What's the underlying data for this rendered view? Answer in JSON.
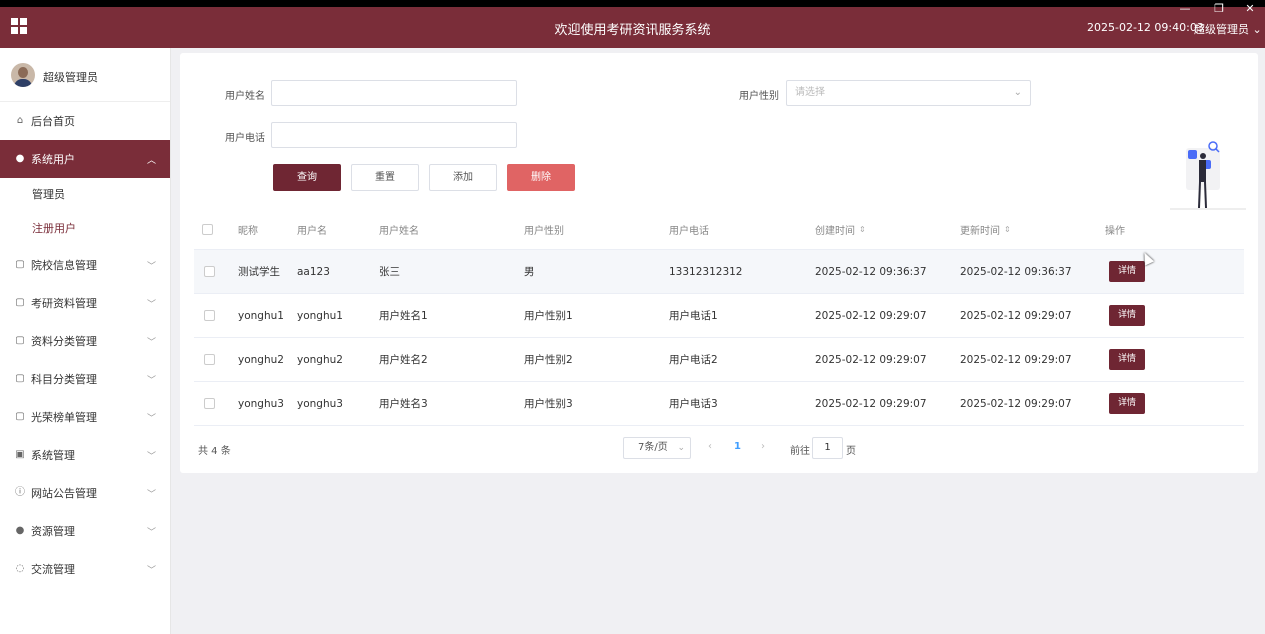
{
  "window": {
    "minimize": "—",
    "restore": "❐",
    "close": "✕"
  },
  "header": {
    "title": "欢迎使用考研资讯服务系统",
    "datetime": "2025-02-12 09:40:03",
    "user_menu": "超级管理员 ⌄"
  },
  "sidebar": {
    "profile_name": "超级管理员",
    "items": [
      {
        "label": "后台首页",
        "icon": "home-icon"
      },
      {
        "label": "系统用户",
        "icon": "user-icon",
        "expanded": true,
        "children": [
          {
            "label": "管理员"
          },
          {
            "label": "注册用户"
          }
        ]
      },
      {
        "label": "院校信息管理",
        "icon": "doc-icon"
      },
      {
        "label": "考研资料管理",
        "icon": "doc-icon"
      },
      {
        "label": "资料分类管理",
        "icon": "doc-icon"
      },
      {
        "label": "科目分类管理",
        "icon": "doc-icon"
      },
      {
        "label": "光荣榜单管理",
        "icon": "doc-icon"
      },
      {
        "label": "系统管理",
        "icon": "image-icon"
      },
      {
        "label": "网站公告管理",
        "icon": "info-icon"
      },
      {
        "label": "资源管理",
        "icon": "location-icon"
      },
      {
        "label": "交流管理",
        "icon": "chat-icon"
      }
    ]
  },
  "search": {
    "name_label": "用户姓名",
    "name_value": "",
    "gender_label": "用户性别",
    "gender_placeholder": "请选择",
    "phone_label": "用户电话",
    "phone_value": ""
  },
  "buttons": {
    "query": "查询",
    "reset": "重置",
    "add": "添加",
    "delete": "删除"
  },
  "table": {
    "headers": [
      "昵称",
      "用户名",
      "用户姓名",
      "用户性别",
      "用户电话",
      "创建时间",
      "更新时间",
      "操作"
    ],
    "sort_icon": "⇕",
    "action_label": "详情",
    "rows": [
      [
        "测试学生",
        "aa123",
        "张三",
        "男",
        "13312312312",
        "2025-02-12 09:36:37",
        "2025-02-12 09:36:37"
      ],
      [
        "yonghu1",
        "yonghu1",
        "用户姓名1",
        "用户性别1",
        "用户电话1",
        "2025-02-12 09:29:07",
        "2025-02-12 09:29:07"
      ],
      [
        "yonghu2",
        "yonghu2",
        "用户姓名2",
        "用户性别2",
        "用户电话2",
        "2025-02-12 09:29:07",
        "2025-02-12 09:29:07"
      ],
      [
        "yonghu3",
        "yonghu3",
        "用户姓名3",
        "用户性别3",
        "用户电话3",
        "2025-02-12 09:29:07",
        "2025-02-12 09:29:07"
      ]
    ]
  },
  "pagination": {
    "total": "共 4 条",
    "page_size": "7条/页",
    "current": "1",
    "goto_prefix": "前往",
    "goto_value": "1",
    "goto_suffix": "页"
  },
  "colors": {
    "brand": "#7a2d39",
    "primary_button": "#6f2633",
    "danger_button": "#e06464"
  }
}
